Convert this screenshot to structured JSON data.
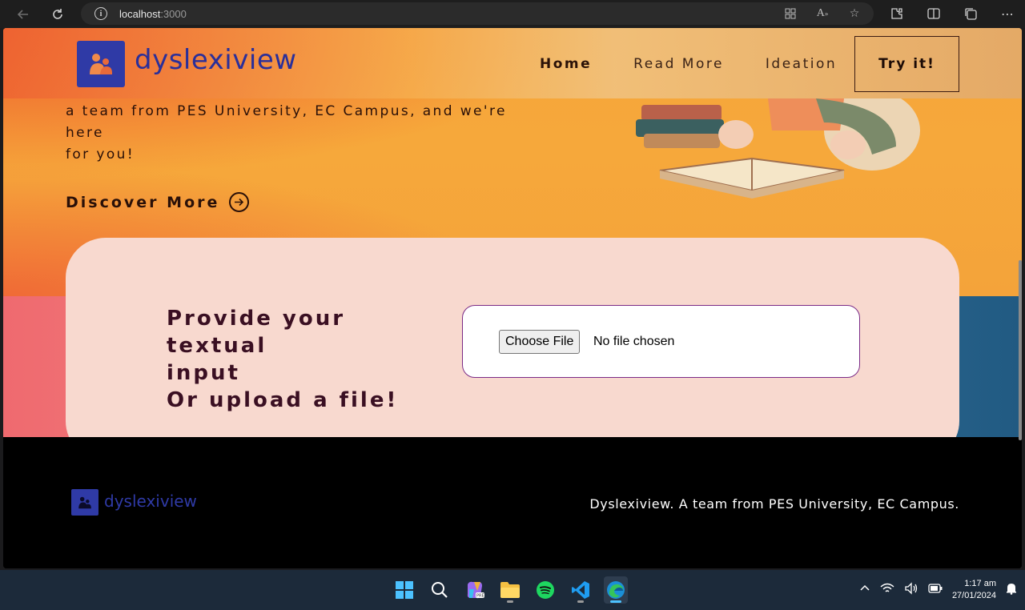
{
  "browser": {
    "url_host": "localhost",
    "url_port": ":3000"
  },
  "navbar": {
    "logo_text": "dyslexiview",
    "links": [
      {
        "label": "Home"
      },
      {
        "label": "Read More"
      },
      {
        "label": "Ideation"
      }
    ],
    "cta_label": "Try it!"
  },
  "hero": {
    "text_line1": "a team from PES University, EC Campus, and we're here",
    "text_line2": "for you!",
    "discover_label": "Discover More"
  },
  "card": {
    "title_line1": "Provide your textual",
    "title_line2": "input",
    "title_line3": "Or upload a file!",
    "choose_file_label": "Choose File",
    "no_file_text": "No file chosen"
  },
  "footer": {
    "logo_text": "dyslexiview",
    "tagline": "Dyslexiview. A team from PES University, EC Campus."
  },
  "taskbar": {
    "time": "1:17 am",
    "date": "27/01/2024",
    "apps": [
      "start-icon",
      "search-icon",
      "copilot-icon",
      "file-explorer-icon",
      "spotify-icon",
      "vscode-icon",
      "edge-icon"
    ]
  },
  "colors": {
    "brand_blue": "#2f3aa6",
    "hero_orange": "#f6a53a",
    "card_pink": "#f8d9cf",
    "title_plum": "#3a0f22"
  }
}
